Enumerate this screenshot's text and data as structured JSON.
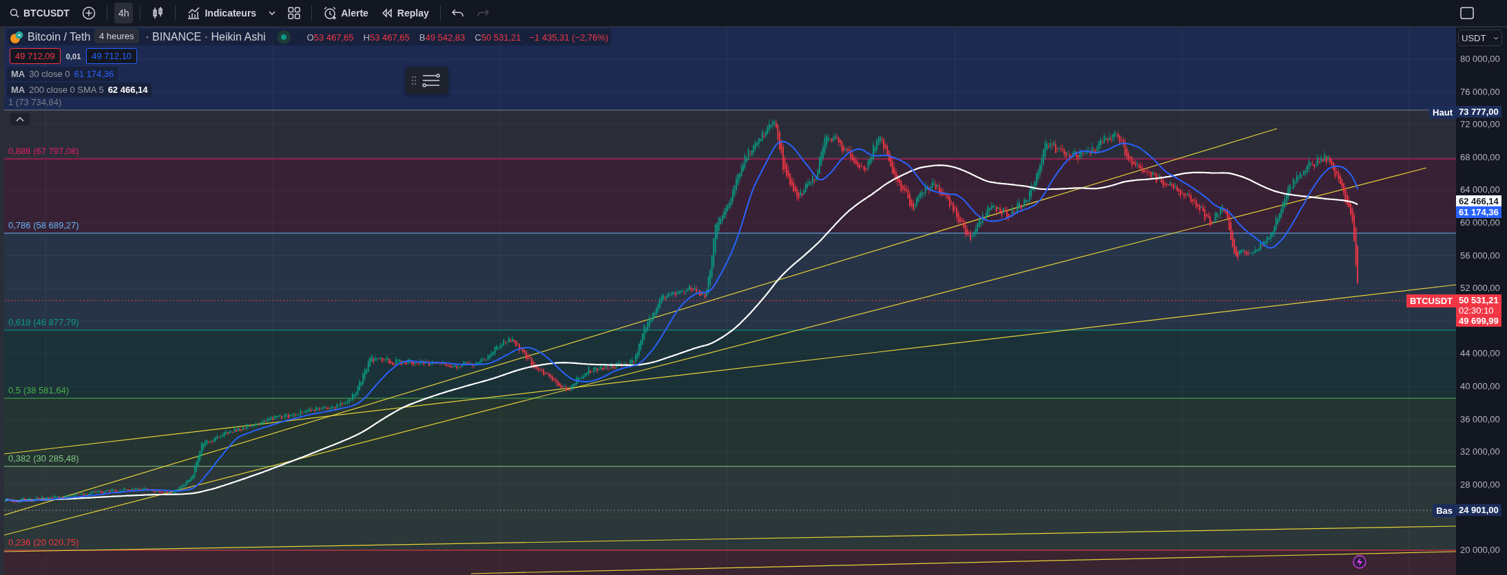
{
  "toolbar": {
    "symbol": "BTCUSDT",
    "interval": {
      "label": "4h",
      "selected": true
    },
    "tooltip": "4 heures",
    "indicators": "Indicateurs",
    "alert": "Alerte",
    "replay": "Replay",
    "redo": {
      "disabled": true
    }
  },
  "legend": {
    "title_parts": [
      "Bitcoin / Teth",
      "· BINANCE · Heikin Ashi"
    ],
    "ohlc": [
      {
        "label": "O",
        "value": "53 467,65"
      },
      {
        "label": "H",
        "value": "53 467,65"
      },
      {
        "label": "B",
        "value": "49 542,83"
      },
      {
        "label": "C",
        "value": "50 531,21"
      }
    ],
    "change": "−1 435,31 (−2,76%)",
    "sell": "49 712,09",
    "spread": "0,01",
    "buy": "49 712,10",
    "indicators": [
      {
        "name": "MA",
        "params": "30 close 0",
        "value": "61 174,36",
        "color": "#2962ff"
      },
      {
        "name": "MA",
        "params": "200 close 0 SMA 5",
        "value": "62 466,14",
        "color": "#ffffff"
      }
    ]
  },
  "chart": {
    "fib_levels": [
      {
        "label": "1 (73 734,84)",
        "color": "#787b86"
      },
      {
        "label": "0,886 (67 797,08)",
        "color": "#e91e63"
      },
      {
        "label": "0,786 (58 689,27)",
        "color": "#64b5f6"
      },
      {
        "label": "0,618 (46 877,79)",
        "color": "#089981"
      },
      {
        "label": "0,5 (38 581,64)",
        "color": "#4caf50"
      },
      {
        "label": "0,382 (30 285,48)",
        "color": "#81c784"
      },
      {
        "label": "0,236 (20 020,75)",
        "color": "#f23645"
      }
    ],
    "high_tag": {
      "label": "Haut",
      "value": "73 777,00"
    },
    "low_tag": {
      "label": "Bas",
      "value": "24 901,00"
    }
  },
  "price_axis": {
    "currency": "USDT",
    "ticks": [
      "80 000,00",
      "76 000,00",
      "72 000,00",
      "68 000,00",
      "64 000,00",
      "60 000,00",
      "56 000,00",
      "52 000,00",
      "44 000,00",
      "40 000,00",
      "36 000,00",
      "32 000,00",
      "28 000,00",
      "20 000,00"
    ],
    "ma_tags": [
      {
        "value": "62 466,14",
        "color": "#ffffff"
      },
      {
        "value": "61 174,36",
        "color": "#2962ff"
      }
    ],
    "last_price": {
      "symbol": "BTCUSDT",
      "value": "50 531,21",
      "countdown": "02:30:10",
      "low": "49 699,99"
    }
  }
}
